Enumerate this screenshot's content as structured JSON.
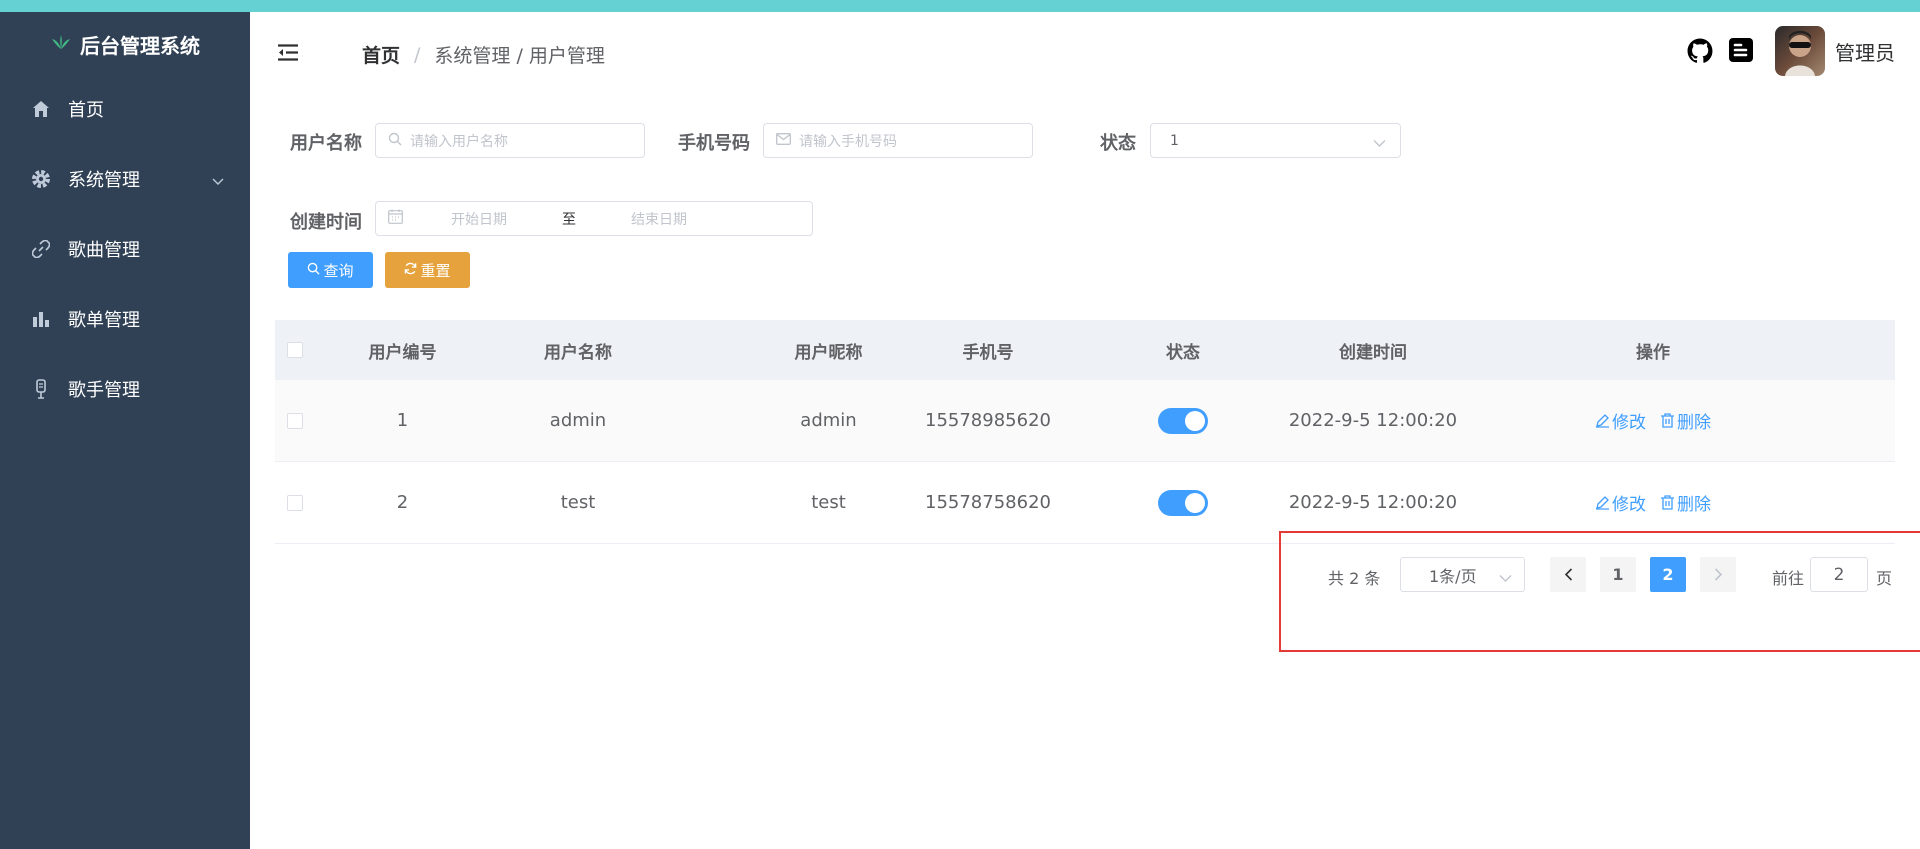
{
  "app": {
    "title": "后台管理系统"
  },
  "sidebar": {
    "items": [
      {
        "label": "首页",
        "icon": "home-icon"
      },
      {
        "label": "系统管理",
        "icon": "gear-icon",
        "expandable": true
      },
      {
        "label": "歌曲管理",
        "icon": "link-icon"
      },
      {
        "label": "歌单管理",
        "icon": "bar-chart-icon"
      },
      {
        "label": "歌手管理",
        "icon": "microphone-icon"
      }
    ]
  },
  "header": {
    "breadcrumb": {
      "home": "首页",
      "sep": "/",
      "rest": "系统管理 / 用户管理"
    },
    "user": {
      "name": "管理员"
    }
  },
  "search": {
    "username": {
      "label": "用户名称",
      "placeholder": "请输入用户名称"
    },
    "phone": {
      "label": "手机号码",
      "placeholder": "请输入手机号码"
    },
    "status": {
      "label": "状态",
      "value": "1"
    },
    "created": {
      "label": "创建时间",
      "start_placeholder": "开始日期",
      "separator": "至",
      "end_placeholder": "结束日期"
    },
    "query_label": "查询",
    "reset_label": "重置"
  },
  "table": {
    "columns": [
      "用户编号",
      "用户名称",
      "用户昵称",
      "手机号",
      "状态",
      "创建时间",
      "操作"
    ],
    "rows": [
      {
        "id": "1",
        "username": "admin",
        "nickname": "admin",
        "phone": "15578985620",
        "enabled": true,
        "created": "2022-9-5 12:00:20"
      },
      {
        "id": "2",
        "username": "test",
        "nickname": "test",
        "phone": "15578758620",
        "enabled": true,
        "created": "2022-9-5 12:00:20"
      }
    ],
    "edit_label": "修改",
    "delete_label": "删除"
  },
  "pagination": {
    "total": "共 2 条",
    "page_size": "1条/页",
    "pages": [
      "1",
      "2"
    ],
    "current_page": "2",
    "goto_label": "前往",
    "goto_value": "2",
    "goto_unit": "页"
  },
  "colors": {
    "accent": "#409eff",
    "warning": "#e6a23c",
    "sidebar": "#304156",
    "topstrip": "#66d1d2",
    "highlight": "#e53935"
  }
}
